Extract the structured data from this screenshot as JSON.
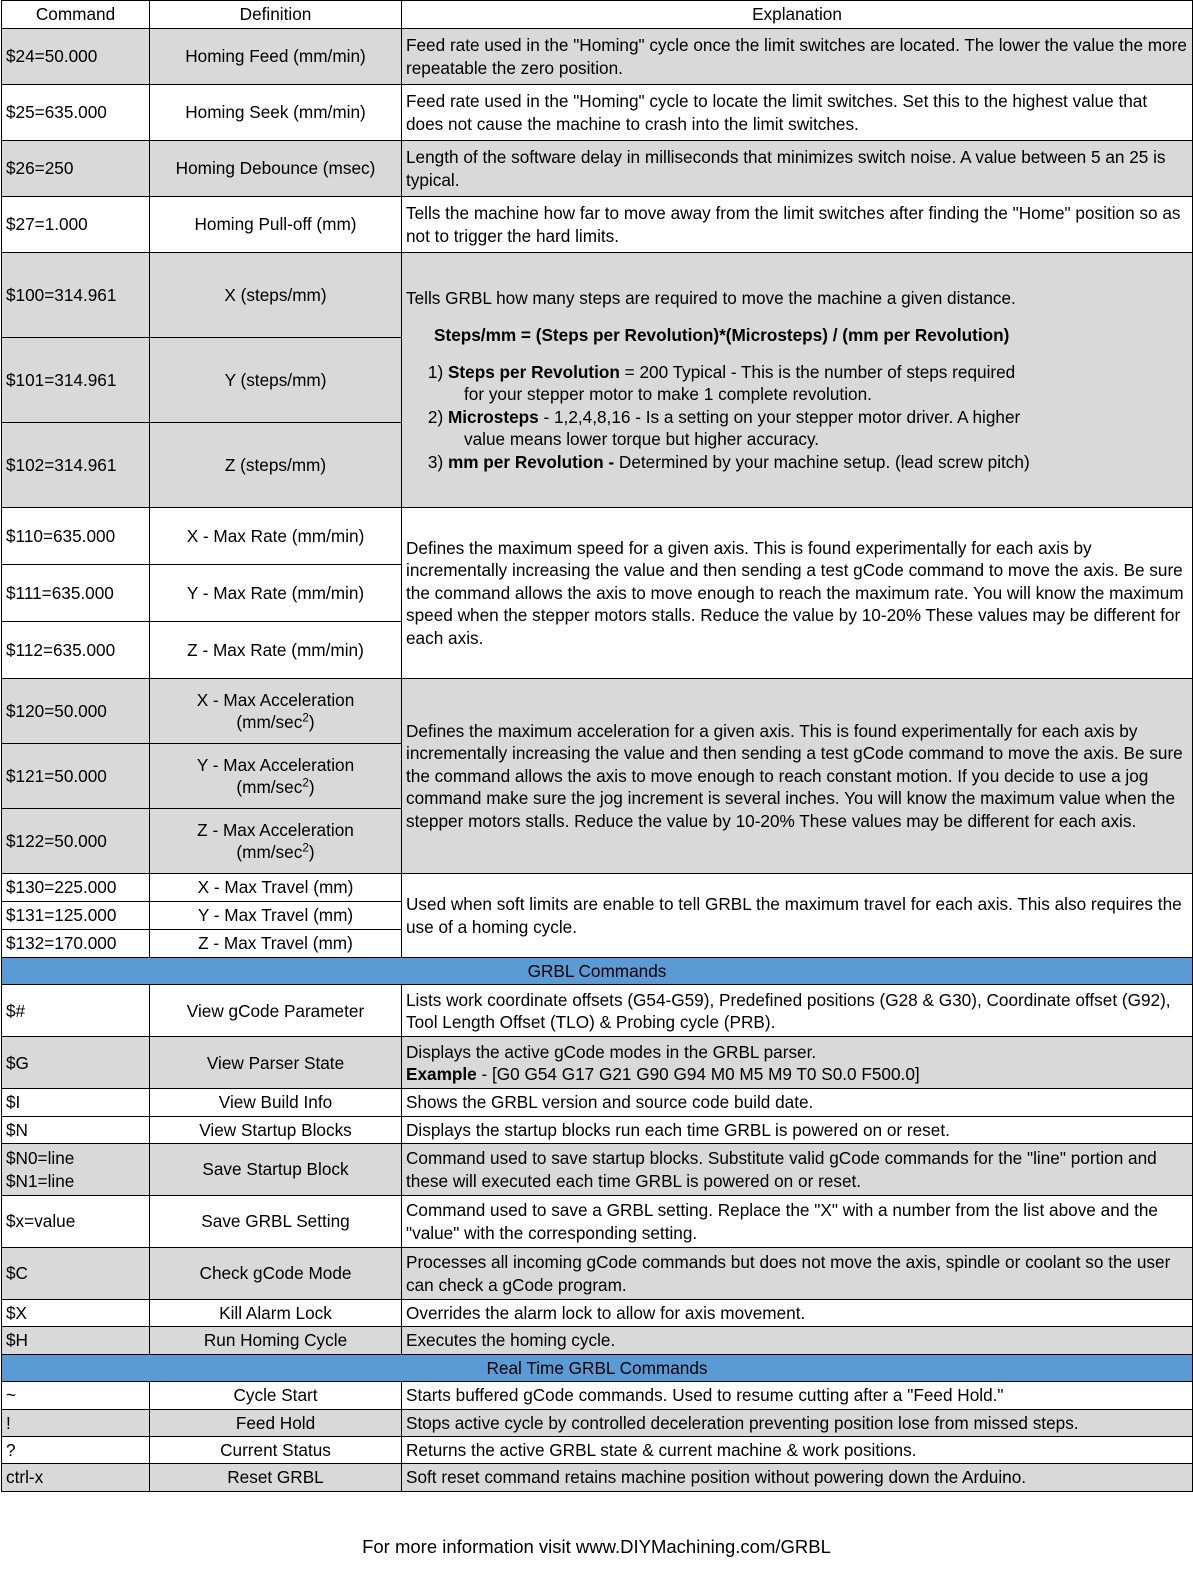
{
  "table": {
    "headers": {
      "command": "Command",
      "definition": "Definition",
      "explanation": "Explanation"
    },
    "colors": {
      "banner": "#5B9BD5",
      "shaded_row": "#D9D9D9",
      "plain_row": "#FFFFFF",
      "border": "#000000"
    },
    "rows": {
      "r24": {
        "command": "$24=50.000",
        "definition": "Homing Feed (mm/min)",
        "explanation": "Feed rate used in the \"Homing\" cycle once the limit switches are located. The lower the value the more repeatable the zero position."
      },
      "r25": {
        "command": "$25=635.000",
        "definition": "Homing Seek (mm/min)",
        "explanation": "Feed rate used in the \"Homing\" cycle to locate the limit switches. Set this to the highest value that does not cause the machine to crash into the limit switches."
      },
      "r26": {
        "command": "$26=250",
        "definition": "Homing Debounce (msec)",
        "explanation": "Length of the software delay in milliseconds that minimizes switch noise. A value between 5 an 25 is typical."
      },
      "r27": {
        "command": "$27=1.000",
        "definition": "Homing Pull-off (mm)",
        "explanation": "Tells the machine how far to move away from the limit switches after finding the \"Home\" position so as not to trigger the hard limits."
      },
      "r100": {
        "command": "$100=314.961",
        "definition": "X (steps/mm)"
      },
      "r101": {
        "command": "$101=314.961",
        "definition": "Y (steps/mm)"
      },
      "r102": {
        "command": "$102=314.961",
        "definition": "Z (steps/mm)"
      },
      "steps_explanation": {
        "intro": "Tells GRBL how many steps are required to move the machine a given distance.",
        "formula": "Steps/mm = (Steps per Revolution)*(Microsteps) / (mm per Revolution)",
        "item1_num": "1) ",
        "item1_bold": "Steps per Revolution",
        "item1_rest": " = 200 Typical - This is the number of steps required",
        "item1_sub": "for your stepper motor to make 1 complete revolution.",
        "item2_num": "2) ",
        "item2_bold": "Microsteps",
        "item2_rest": " - 1,2,4,8,16 - Is a setting on your stepper motor driver. A higher",
        "item2_sub": "value means lower torque but higher accuracy.",
        "item3_num": "3) ",
        "item3_bold": "mm per Revolution -",
        "item3_rest": " Determined by your machine setup. (lead screw pitch)"
      },
      "r110": {
        "command": "$110=635.000",
        "definition": "X - Max Rate (mm/min)"
      },
      "r111": {
        "command": "$111=635.000",
        "definition": "Y - Max Rate (mm/min)"
      },
      "r112": {
        "command": "$112=635.000",
        "definition": "Z - Max Rate (mm/min)"
      },
      "maxrate_explanation": "Defines the maximum speed for a given axis. This is found experimentally for each axis by incrementally  increasing the value and then sending a test gCode command to move the axis. Be sure the command allows the axis to move enough to reach the maximum rate. You will know the maximum speed when the stepper motors stalls. Reduce the value by 10-20% These values may be different for each axis.",
      "r120": {
        "command": "$120=50.000",
        "definition_line1": "X - Max Acceleration",
        "definition_line2a": "(mm/sec",
        "definition_line2sup": "2",
        "definition_line2b": ")"
      },
      "r121": {
        "command": "$121=50.000",
        "definition_line1": "Y - Max Acceleration",
        "definition_line2a": "(mm/sec",
        "definition_line2sup": "2",
        "definition_line2b": ")"
      },
      "r122": {
        "command": "$122=50.000",
        "definition_line1": "Z - Max Acceleration",
        "definition_line2a": "(mm/sec",
        "definition_line2sup": "2",
        "definition_line2b": ")"
      },
      "maxaccel_explanation": "Defines the maximum acceleration for a given axis. This is found experimentally for each axis by incrementally  increasing the value and then sending a test gCode command to move the axis. Be sure the command allows the axis to move enough to reach constant motion. If you decide to use a jog command make sure the jog increment is several inches. You will know the maximum value when the stepper motors stalls. Reduce the value by 10-20% These values may be different for each axis.",
      "r130": {
        "command": "$130=225.000",
        "definition": "X - Max Travel (mm)"
      },
      "r131": {
        "command": "$131=125.000",
        "definition": "Y - Max Travel (mm)"
      },
      "r132": {
        "command": "$132=170.000",
        "definition": "Z - Max Travel (mm)"
      },
      "maxtravel_explanation": "Used when soft limits are enable to tell GRBL the maximum travel for each axis. This also requires the use of a homing cycle.",
      "banner_grbl": "GRBL Commands",
      "g_hash": {
        "command": "$#",
        "definition": "View gCode Parameter",
        "explanation": "Lists work coordinate offsets (G54-G59), Predefined positions (G28 & G30), Coordinate offset (G92), Tool Length Offset (TLO) & Probing cycle (PRB)."
      },
      "g_g": {
        "command": "$G",
        "definition": "View Parser State",
        "explanation_line1": "Displays the active gCode modes in the GRBL parser.",
        "explanation_line2_bold": "Example",
        "explanation_line2_rest": " - [G0 G54 G17 G21 G90 G94 M0 M5 M9 T0 S0.0 F500.0]"
      },
      "g_i": {
        "command": "$I",
        "definition": "View Build Info",
        "explanation": "Shows the GRBL version and source code build date."
      },
      "g_n": {
        "command": "$N",
        "definition": "View Startup Blocks",
        "explanation": "Displays the startup blocks run each time GRBL is powered on or reset."
      },
      "g_n0": {
        "command": "$N0=line\n$N1=line",
        "definition": "Save Startup Block",
        "explanation": "Command used to save startup blocks. Substitute valid gCode commands for the \"line\" portion and these will executed each time GRBL is powered on or reset."
      },
      "g_xval": {
        "command": "$x=value",
        "definition": "Save GRBL Setting",
        "explanation": "Command used to save a GRBL setting. Replace the \"X\" with a number from the list above and the \"value\" with the corresponding setting."
      },
      "g_c": {
        "command": "$C",
        "definition": "Check gCode Mode",
        "explanation": "Processes all incoming gCode commands but does not move the axis, spindle or coolant so the user can check a gCode program."
      },
      "g_x": {
        "command": "$X",
        "definition": "Kill Alarm Lock",
        "explanation": "Overrides the alarm lock to allow for axis movement."
      },
      "g_h": {
        "command": "$H",
        "definition": "Run Homing Cycle",
        "explanation": "Executes the homing cycle."
      },
      "banner_realtime": "Real Time GRBL Commands",
      "rt_tilde": {
        "command": "~",
        "definition": "Cycle Start",
        "explanation": "Starts buffered gCode commands. Used to resume cutting after a \"Feed Hold.\""
      },
      "rt_bang": {
        "command": "!",
        "definition": "Feed Hold",
        "explanation": "Stops active cycle by controlled deceleration preventing position lose from missed steps."
      },
      "rt_question": {
        "command": "?",
        "definition": "Current Status",
        "explanation": "Returns the active GRBL state & current machine & work positions."
      },
      "rt_ctrlx": {
        "command": "ctrl-x",
        "definition": "Reset GRBL",
        "explanation": "Soft reset command retains machine position without powering down the Arduino."
      }
    }
  },
  "footer": {
    "text": "For more information visit www.DIYMachining.com/GRBL"
  }
}
